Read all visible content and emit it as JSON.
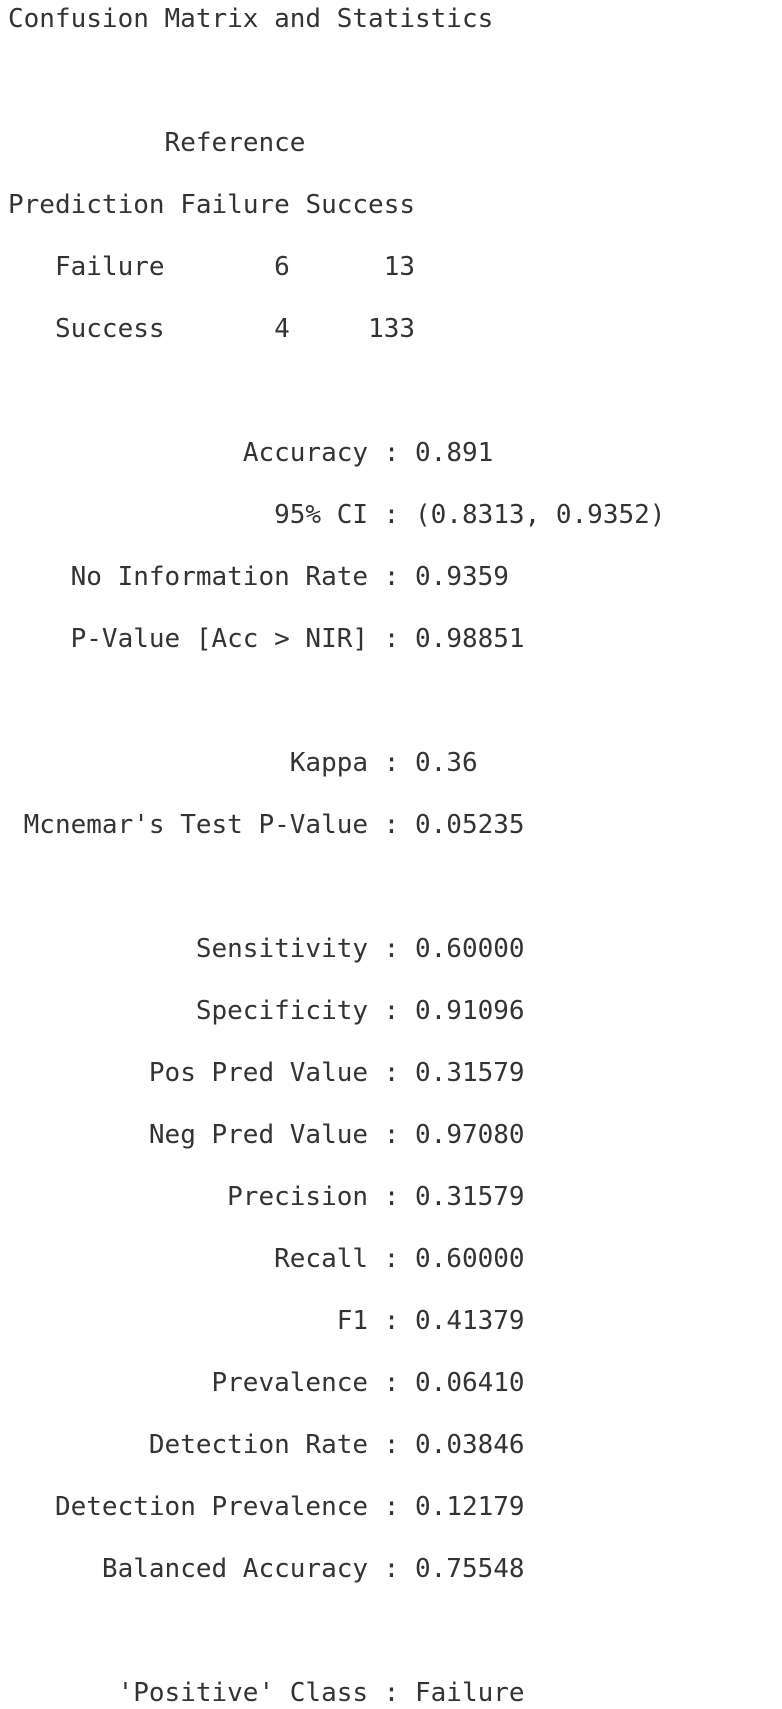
{
  "console": {
    "header": "Confusion Matrix and Statistics",
    "matrix": {
      "reference_label": "Reference",
      "prediction_label": "Prediction",
      "columns": [
        "Failure",
        "Success"
      ],
      "rows": [
        {
          "label": "Failure",
          "values": [
            "6",
            "13"
          ]
        },
        {
          "label": "Success",
          "values": [
            "4",
            "133"
          ]
        }
      ]
    },
    "overall": [
      {
        "label": "Accuracy",
        "value": "0.891"
      },
      {
        "label": "95% CI",
        "value": "(0.8313, 0.9352)"
      },
      {
        "label": "No Information Rate",
        "value": "0.9359"
      },
      {
        "label": "P-Value [Acc > NIR]",
        "value": "0.98851"
      }
    ],
    "agreement": [
      {
        "label": "Kappa",
        "value": "0.36"
      },
      {
        "label": "Mcnemar's Test P-Value",
        "value": "0.05235"
      }
    ],
    "by_class": [
      {
        "label": "Sensitivity",
        "value": "0.60000"
      },
      {
        "label": "Specificity",
        "value": "0.91096"
      },
      {
        "label": "Pos Pred Value",
        "value": "0.31579"
      },
      {
        "label": "Neg Pred Value",
        "value": "0.97080"
      },
      {
        "label": "Precision",
        "value": "0.31579"
      },
      {
        "label": "Recall",
        "value": "0.60000"
      },
      {
        "label": "F1",
        "value": "0.41379"
      },
      {
        "label": "Prevalence",
        "value": "0.06410"
      },
      {
        "label": "Detection Rate",
        "value": "0.03846"
      },
      {
        "label": "Detection Prevalence",
        "value": "0.12179"
      },
      {
        "label": "Balanced Accuracy",
        "value": "0.75548"
      }
    ],
    "positive_class": {
      "label": "'Positive' Class",
      "value": "Failure"
    }
  }
}
